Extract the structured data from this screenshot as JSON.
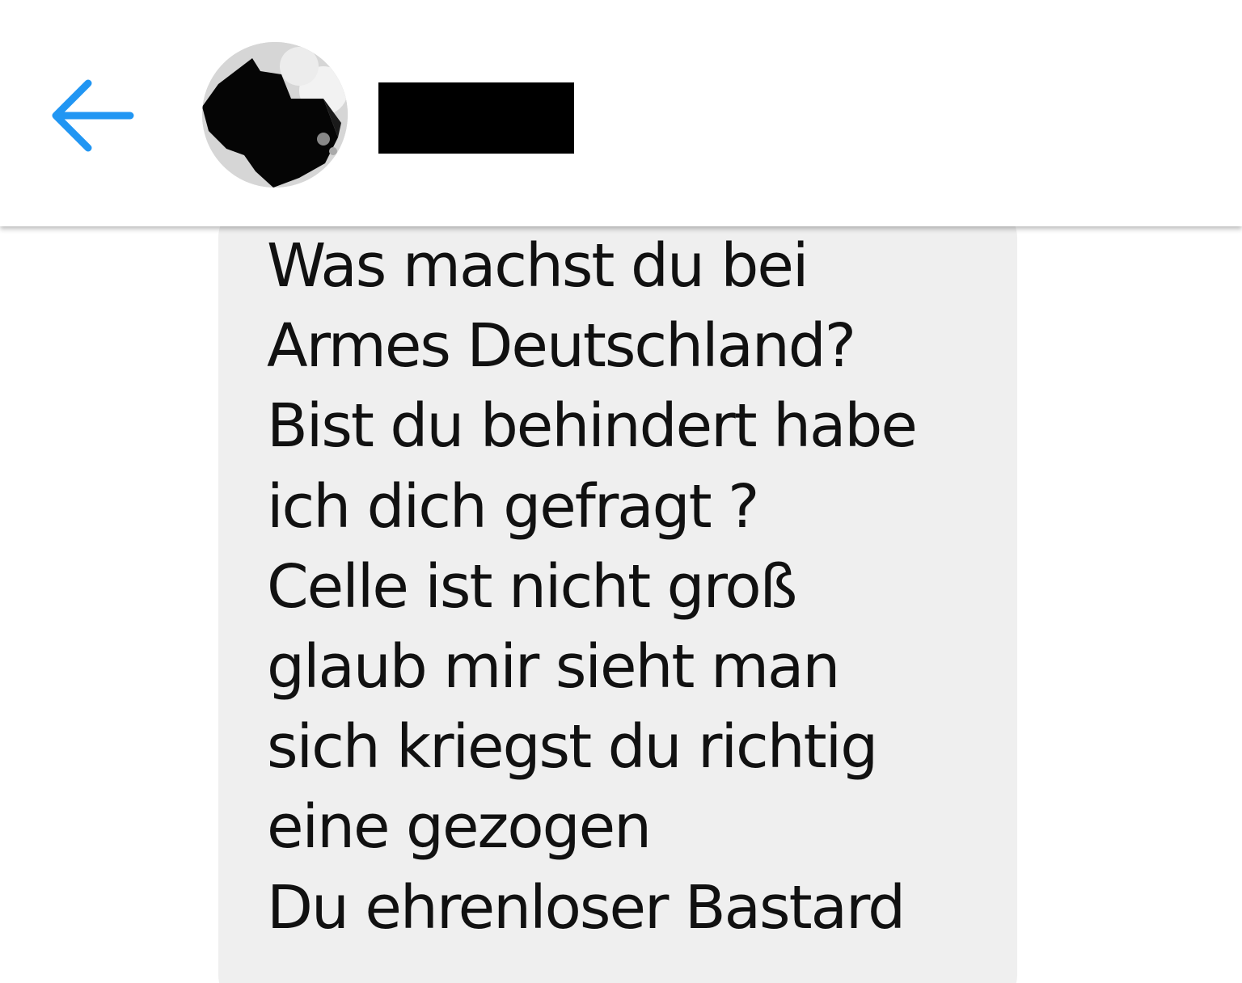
{
  "header": {
    "back_icon": "arrow-left-icon",
    "accent_color": "#2196f3",
    "avatar_icon": "profile-photo",
    "contact_name_redacted": true
  },
  "messages": [
    {
      "direction": "incoming",
      "text": "Was machst du bei\nArmes Deutschland?\nBist du behindert habe\nich dich gefragt ?\nCelle ist nicht groß\nglaub mir sieht man\nsich kriegst du richtig\neine gezogen\nDu ehrenloser Bastard"
    }
  ]
}
